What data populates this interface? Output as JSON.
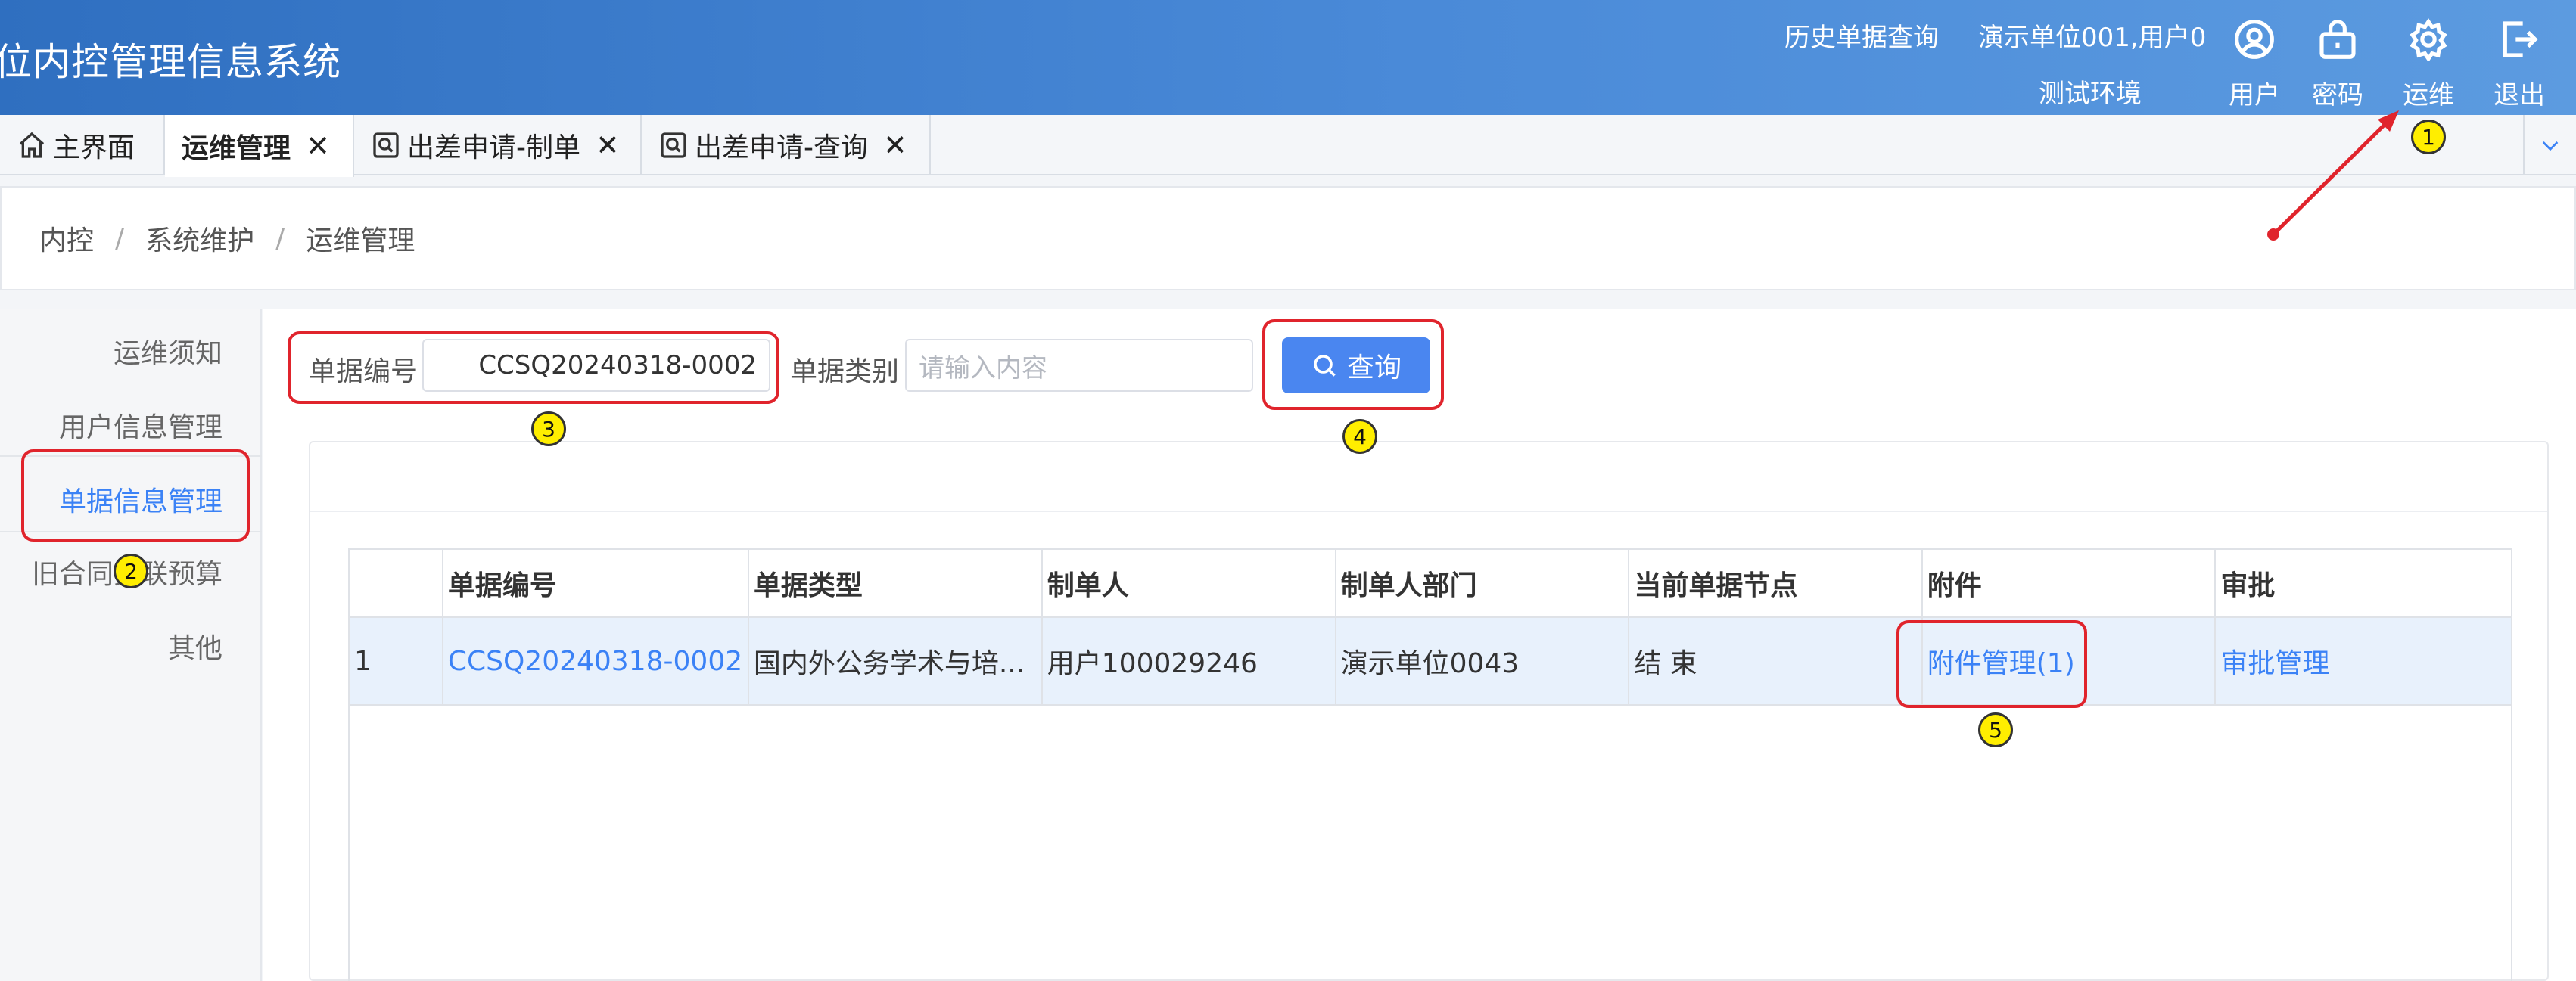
{
  "header": {
    "app_title": "位内控管理信息系统",
    "history_link": "历史单据查询",
    "unit_user": "演示单位001,用户0",
    "env": "测试环境",
    "tools": [
      {
        "label": "用户",
        "icon": "user-icon"
      },
      {
        "label": "密码",
        "icon": "lock-icon"
      },
      {
        "label": "运维",
        "icon": "gear-icon"
      },
      {
        "label": "退出",
        "icon": "logout-icon"
      }
    ]
  },
  "tabs": [
    {
      "label": "主界面",
      "icon": "home-icon",
      "closable": false
    },
    {
      "label": "运维管理",
      "active": true,
      "closable": true
    },
    {
      "label": "出差申请-制单",
      "icon": "search-doc-icon",
      "closable": true
    },
    {
      "label": "出差申请-查询",
      "icon": "search-doc-icon",
      "closable": true
    }
  ],
  "tab_close_glyph": "✕",
  "breadcrumb": [
    "内控",
    "系统维护",
    "运维管理"
  ],
  "breadcrumb_sep": "/",
  "sidebar": {
    "items": [
      "运维须知",
      "用户信息管理",
      "单据信息管理",
      "旧合同关联预算",
      "其他"
    ],
    "active_index": 2
  },
  "search": {
    "doc_no_label": "单据编号",
    "doc_no_value": "CCSQ20240318-0002",
    "doc_type_label": "单据类别",
    "doc_type_placeholder": "请输入内容",
    "query_button": "查询"
  },
  "table": {
    "columns": [
      "",
      "单据编号",
      "单据类型",
      "制单人",
      "制单人部门",
      "当前单据节点",
      "附件",
      "审批"
    ],
    "rows": [
      [
        "1",
        "CCSQ20240318-0002",
        "国内外公务学术与培...",
        "用户100029246",
        "演示单位0043",
        "结 束",
        "附件管理(1)",
        "审批管理"
      ]
    ]
  },
  "annotations": [
    "1",
    "2",
    "3",
    "4",
    "5"
  ],
  "colors": {
    "header_start": "#2f6fc0",
    "header_end": "#5c9be0",
    "accent": "#3b82f6",
    "button": "#4a86f0",
    "highlight": "#e0242c",
    "marker": "#ffee00",
    "row_selected": "#e8f1fc"
  }
}
